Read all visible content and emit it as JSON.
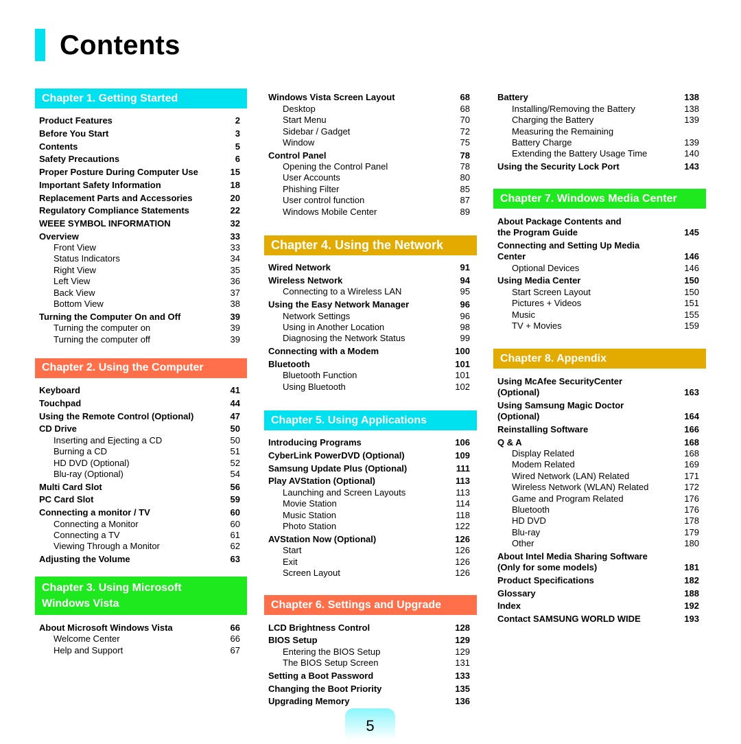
{
  "page_title": "Contents",
  "page_number": "5",
  "colors": {
    "cyan": "#00e1ef",
    "orange": "#ff6f4a",
    "green": "#1ee81e",
    "gold": "#e3aa00"
  },
  "ch1": {
    "title": "Chapter 1. Getting Started",
    "items": [
      {
        "t": "Product Features",
        "p": "2",
        "b": true
      },
      {
        "t": "Before You Start",
        "p": "3",
        "b": true
      },
      {
        "t": "Contents",
        "p": "5",
        "b": true
      },
      {
        "t": "Safety Precautions",
        "p": "6",
        "b": true
      },
      {
        "t": "Proper Posture During Computer Use",
        "p": "15",
        "b": true
      },
      {
        "t": "Important Safety Information",
        "p": "18",
        "b": true
      },
      {
        "t": "Replacement Parts and Accessories",
        "p": "20",
        "b": true
      },
      {
        "t": "Regulatory Compliance Statements",
        "p": "22",
        "b": true
      },
      {
        "t": "WEEE SYMBOL INFORMATION",
        "p": "32",
        "b": true
      },
      {
        "t": "Overview",
        "p": "33",
        "b": true
      },
      {
        "t": "Front View",
        "p": "33"
      },
      {
        "t": "Status Indicators",
        "p": "34"
      },
      {
        "t": "Right View",
        "p": "35"
      },
      {
        "t": "Left View",
        "p": "36"
      },
      {
        "t": "Back View",
        "p": "37"
      },
      {
        "t": "Bottom View",
        "p": "38"
      },
      {
        "t": "Turning the Computer On and Off",
        "p": "39",
        "b": true
      },
      {
        "t": "Turning the computer on",
        "p": "39"
      },
      {
        "t": "Turning the computer off",
        "p": "39"
      }
    ]
  },
  "ch2": {
    "title": "Chapter 2. Using the Computer",
    "items": [
      {
        "t": "Keyboard",
        "p": "41",
        "b": true
      },
      {
        "t": "Touchpad",
        "p": "44",
        "b": true
      },
      {
        "t": "Using the Remote Control (Optional)",
        "p": "47",
        "b": true
      },
      {
        "t": "CD Drive",
        "p": "50",
        "b": true
      },
      {
        "t": "Inserting and Ejecting a CD",
        "p": "50"
      },
      {
        "t": "Burning a CD",
        "p": "51"
      },
      {
        "t": "HD DVD (Optional)",
        "p": "52"
      },
      {
        "t": "Blu-ray (Optional)",
        "p": "54"
      },
      {
        "t": "Multi Card Slot",
        "p": "56",
        "b": true
      },
      {
        "t": "PC Card Slot",
        "p": "59",
        "b": true
      },
      {
        "t": "Connecting a monitor / TV",
        "p": "60",
        "b": true
      },
      {
        "t": "Connecting a Monitor",
        "p": "60"
      },
      {
        "t": "Connecting a TV",
        "p": "61"
      },
      {
        "t": "Viewing Through a Monitor",
        "p": "62"
      },
      {
        "t": "Adjusting the Volume",
        "p": "63",
        "b": true
      }
    ]
  },
  "ch3": {
    "title_line1": "Chapter 3. Using Microsoft",
    "title_line2": "Windows Vista",
    "items": [
      {
        "t": "About Microsoft Windows Vista",
        "p": "66",
        "b": true
      },
      {
        "t": "Welcome Center",
        "p": "66"
      },
      {
        "t": "Help and Support",
        "p": "67"
      }
    ]
  },
  "ch3_cont": {
    "items": [
      {
        "t": "Windows Vista Screen Layout",
        "p": "68",
        "b": true
      },
      {
        "t": "Desktop",
        "p": "68"
      },
      {
        "t": "Start Menu",
        "p": "70"
      },
      {
        "t": "Sidebar / Gadget",
        "p": "72"
      },
      {
        "t": "Window",
        "p": "75"
      },
      {
        "t": "Control Panel",
        "p": "78",
        "b": true
      },
      {
        "t": "Opening the Control Panel",
        "p": "78"
      },
      {
        "t": "User Accounts",
        "p": "80"
      },
      {
        "t": "Phishing Filter",
        "p": "85"
      },
      {
        "t": "User control function",
        "p": "87"
      },
      {
        "t": "Windows Mobile Center",
        "p": "89"
      }
    ]
  },
  "ch4": {
    "title": "Chapter 4. Using the Network",
    "items": [
      {
        "t": "Wired Network",
        "p": "91",
        "b": true
      },
      {
        "t": "Wireless Network",
        "p": "94",
        "b": true
      },
      {
        "t": "Connecting to a Wireless LAN",
        "p": "95"
      },
      {
        "t": "Using the Easy Network Manager",
        "p": "96",
        "b": true
      },
      {
        "t": "Network Settings",
        "p": "96"
      },
      {
        "t": "Using in Another Location",
        "p": "98"
      },
      {
        "t": "Diagnosing the Network Status",
        "p": "99"
      },
      {
        "t": "Connecting with a Modem",
        "p": "100",
        "b": true
      },
      {
        "t": "Bluetooth",
        "p": "101",
        "b": true
      },
      {
        "t": "Bluetooth Function",
        "p": "101"
      },
      {
        "t": "Using Bluetooth",
        "p": "102"
      }
    ]
  },
  "ch5": {
    "title": "Chapter 5. Using Applications",
    "items": [
      {
        "t": "Introducing Programs",
        "p": "106",
        "b": true
      },
      {
        "t": "CyberLink PowerDVD (Optional)",
        "p": "109",
        "b": true
      },
      {
        "t": "Samsung Update Plus (Optional)",
        "p": "111",
        "b": true
      },
      {
        "t": "Play AVStation (Optional)",
        "p": "113",
        "b": true
      },
      {
        "t": "Launching and Screen Layouts",
        "p": "113"
      },
      {
        "t": "Movie Station",
        "p": "114"
      },
      {
        "t": "Music Station",
        "p": "118"
      },
      {
        "t": "Photo Station",
        "p": "122"
      },
      {
        "t": "AVStation Now (Optional)",
        "p": "126",
        "b": true
      },
      {
        "t": "Start",
        "p": "126"
      },
      {
        "t": "Exit",
        "p": "126"
      },
      {
        "t": "Screen Layout",
        "p": "126"
      }
    ]
  },
  "ch6": {
    "title": "Chapter 6. Settings and Upgrade",
    "items": [
      {
        "t": "LCD Brightness Control",
        "p": "128",
        "b": true
      },
      {
        "t": "BIOS Setup",
        "p": "129",
        "b": true
      },
      {
        "t": "Entering the BIOS Setup",
        "p": "129"
      },
      {
        "t": "The BIOS Setup Screen",
        "p": "131"
      },
      {
        "t": "Setting a Boot Password",
        "p": "133",
        "b": true
      },
      {
        "t": "Changing the Boot Priority",
        "p": "135",
        "b": true
      },
      {
        "t": "Upgrading Memory",
        "p": "136",
        "b": true
      }
    ]
  },
  "ch6_cont": {
    "items": [
      {
        "t": "Battery",
        "p": "138",
        "b": true
      },
      {
        "t": "Installing/Removing the Battery",
        "p": "138"
      },
      {
        "t": "Charging the Battery",
        "p": "139"
      },
      {
        "t": "Measuring the Remaining",
        "p": ""
      },
      {
        "t": "Battery Charge",
        "p": "139"
      },
      {
        "t": "Extending the Battery Usage Time",
        "p": "140"
      },
      {
        "t": "Using the Security Lock Port",
        "p": "143",
        "b": true
      }
    ]
  },
  "ch7": {
    "title": "Chapter 7. Windows Media Center",
    "items": [
      {
        "t": "About Package Contents and",
        "p": "",
        "b": true
      },
      {
        "t": "the Program Guide",
        "p": "145",
        "b": true,
        "cont": true
      },
      {
        "t": "Connecting and Setting Up Media",
        "p": "",
        "b": true
      },
      {
        "t": "Center",
        "p": "146",
        "b": true,
        "cont": true
      },
      {
        "t": "Optional Devices",
        "p": "146"
      },
      {
        "t": "Using Media Center",
        "p": "150",
        "b": true
      },
      {
        "t": "Start Screen Layout",
        "p": "150"
      },
      {
        "t": "Pictures + Videos",
        "p": "151"
      },
      {
        "t": "Music",
        "p": "155"
      },
      {
        "t": "TV + Movies",
        "p": "159"
      }
    ]
  },
  "ch8": {
    "title": "Chapter 8. Appendix",
    "items": [
      {
        "t": "Using McAfee SecurityCenter",
        "p": "",
        "b": true
      },
      {
        "t": "(Optional)",
        "p": "163",
        "b": true,
        "cont": true
      },
      {
        "t": "Using Samsung Magic Doctor",
        "p": "",
        "b": true
      },
      {
        "t": "(Optional)",
        "p": "164",
        "b": true,
        "cont": true
      },
      {
        "t": "Reinstalling Software",
        "p": "166",
        "b": true
      },
      {
        "t": "Q & A",
        "p": "168",
        "b": true
      },
      {
        "t": "Display Related",
        "p": "168"
      },
      {
        "t": "Modem Related",
        "p": "169"
      },
      {
        "t": "Wired Network (LAN) Related",
        "p": "171"
      },
      {
        "t": "Wireless Network (WLAN) Related",
        "p": "172"
      },
      {
        "t": "Game and Program Related",
        "p": "176"
      },
      {
        "t": "Bluetooth",
        "p": "176"
      },
      {
        "t": "HD DVD",
        "p": "178"
      },
      {
        "t": "Blu-ray",
        "p": "179"
      },
      {
        "t": "Other",
        "p": "180"
      },
      {
        "t": "About Intel Media Sharing Software",
        "p": "",
        "b": true
      },
      {
        "t": "(Only for some models)",
        "p": "181",
        "b": true,
        "cont": true
      },
      {
        "t": "Product Specifications",
        "p": "182",
        "b": true
      },
      {
        "t": "Glossary",
        "p": "188",
        "b": true
      },
      {
        "t": "Index",
        "p": "192",
        "b": true
      },
      {
        "t": "Contact SAMSUNG WORLD WIDE",
        "p": "193",
        "b": true
      }
    ]
  }
}
